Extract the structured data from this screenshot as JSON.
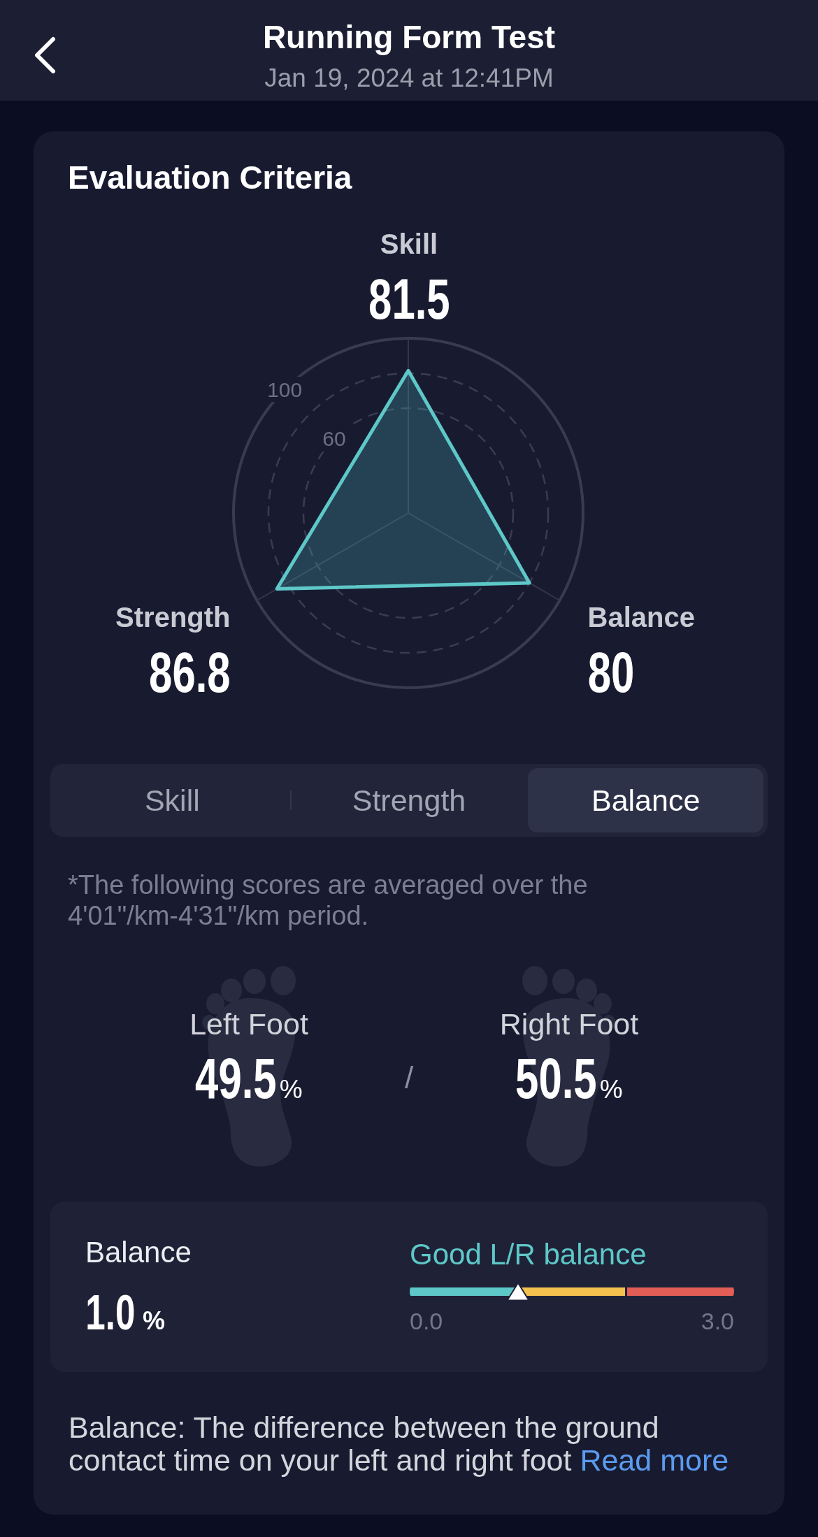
{
  "header": {
    "title": "Running Form Test",
    "subtitle": "Jan 19, 2024 at 12:41PM"
  },
  "evaluation": {
    "title": "Evaluation Criteria",
    "chart_data": {
      "type": "radar",
      "categories": [
        "Skill",
        "Balance",
        "Strength"
      ],
      "values": [
        81.5,
        80,
        86.8
      ],
      "ylim": [
        0,
        100
      ],
      "yticks": [
        60,
        100
      ],
      "data_labels": true
    }
  },
  "tabs": [
    {
      "label": "Skill",
      "selected": false
    },
    {
      "label": "Strength",
      "selected": false
    },
    {
      "label": "Balance",
      "selected": true
    }
  ],
  "note": "*The following scores are averaged over the 4'01\"/km-4'31\"/km period.",
  "feet": [
    {
      "kind": "left",
      "label": "Left Foot",
      "value": "49.5",
      "unit": "%"
    },
    {
      "kind": "right",
      "label": "Right Foot",
      "value": "50.5",
      "unit": "%"
    }
  ],
  "separator": "/",
  "balance_card": {
    "label": "Balance",
    "value": "1.0",
    "unit": "%",
    "status": "Good L/R balance",
    "scale": {
      "level": 0.333,
      "min_label": "0.0",
      "max_label": "3.0",
      "zones": [
        {
          "color": "#5ec8c8"
        },
        {
          "color": "#f2c14e"
        },
        {
          "color": "#e35d57"
        }
      ]
    }
  },
  "description": {
    "text": "Balance: The difference between the ground contact time on your left and right foot",
    "link": "Read more"
  }
}
